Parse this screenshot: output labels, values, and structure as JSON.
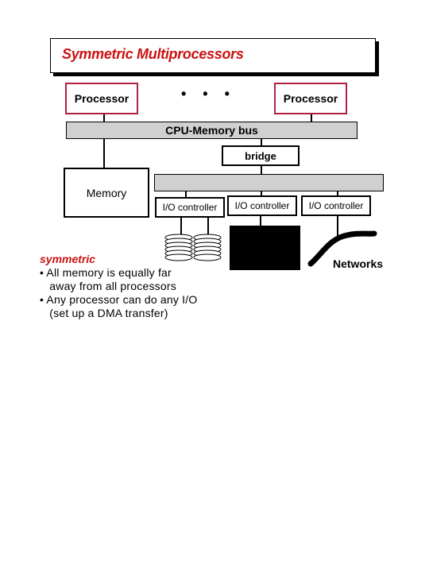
{
  "title": "Symmetric Multiprocessors",
  "diagram": {
    "processor_left": "Processor",
    "processor_right": "Processor",
    "ellipsis": "• • •",
    "cpu_bus": "CPU-Memory bus",
    "bridge": "bridge",
    "memory": "Memory",
    "io_controllers": [
      "I/O controller",
      "I/O controller",
      "I/O controller"
    ],
    "networks": "Networks"
  },
  "notes": {
    "heading": "symmetric",
    "bullets": [
      "• All memory is equally far\n   away from all processors",
      "• Any processor can do any I/O\n   (set up a DMA transfer)"
    ]
  },
  "colors": {
    "accent": "#cc1111",
    "processor_border": "#b02040",
    "bus_fill": "#d0d0d0"
  }
}
